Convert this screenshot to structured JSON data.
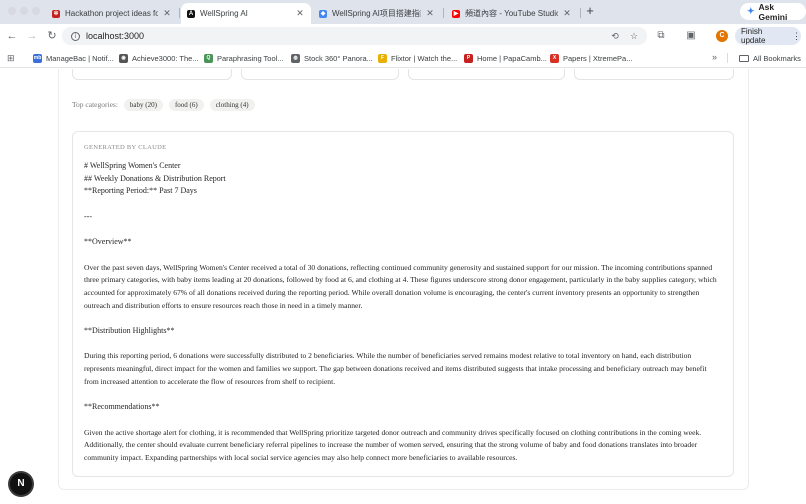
{
  "browser": {
    "tabs": [
      {
        "title": "Hackathon project ideas for a...",
        "favicon": "gear-icon",
        "favicon_color": "#c5221f",
        "active": false
      },
      {
        "title": "WellSpring AI",
        "favicon": "anthropic-icon",
        "favicon_color": "#111111",
        "active": true
      },
      {
        "title": "WellSpring AI项目搭建指南请...",
        "favicon": "chatbot-icon",
        "favicon_color": "#4285f4",
        "active": false
      },
      {
        "title": "頻道內容 - YouTube Studio",
        "favicon": "youtube-icon",
        "favicon_color": "#ff0000",
        "active": false
      }
    ],
    "new_tab_label": "+",
    "ask_gemini_label": "Ask Gemini",
    "url": "localhost:3000",
    "avatar_initial": "C",
    "finish_update_label": "Finish update",
    "bookmarks": [
      {
        "label": "ManageBac | Notif...",
        "icon": "managebac-icon",
        "color": "#3a6fd8"
      },
      {
        "label": "Achieve3000: The...",
        "icon": "person-icon",
        "color": "#555555"
      },
      {
        "label": "Paraphrasing Tool...",
        "icon": "quillbot-icon",
        "color": "#499557"
      },
      {
        "label": "Stock 360° Panora...",
        "icon": "globe-icon",
        "color": "#5f6368"
      },
      {
        "label": "Flixtor | Watch the...",
        "icon": "flixtor-icon",
        "color": "#e8b007"
      },
      {
        "label": "Home | PapaCamb...",
        "icon": "papacambridge-icon",
        "color": "#c5221f"
      },
      {
        "label": "Papers | XtremePa...",
        "icon": "xtremepapers-icon",
        "color": "#d93025"
      }
    ],
    "all_bookmarks_label": "All Bookmarks"
  },
  "page": {
    "categories_label": "Top categories:",
    "categories": [
      "baby (20)",
      "food (6)",
      "clothing (4)"
    ],
    "report": {
      "generated_by": "GENERATED BY CLAUDE",
      "heading_lines": [
        "# WellSpring Women's Center",
        "## Weekly Donations & Distribution Report",
        "**Reporting Period:** Past 7 Days"
      ],
      "separator": "---",
      "overview_heading": "**Overview**",
      "overview_text": "Over the past seven days, WellSpring Women's Center received a total of 30 donations, reflecting continued community generosity and sustained support for our mission. The incoming contributions spanned three primary categories, with baby items leading at 20 donations, followed by food at 6, and clothing at 4. These figures underscore strong donor engagement, particularly in the baby supplies category, which accounted for approximately 67% of all donations received during the reporting period. While overall donation volume is encouraging, the center's current inventory presents an opportunity to strengthen outreach and distribution efforts to ensure resources reach those in need in a timely manner.",
      "distribution_heading": "**Distribution Highlights**",
      "distribution_text": "During this reporting period, 6 donations were successfully distributed to 2 beneficiaries. While the number of beneficiaries served remains modest relative to total inventory on hand, each distribution represents meaningful, direct impact for the women and families we support. The gap between donations received and items distributed suggests that intake processing and beneficiary outreach may benefit from increased attention to accelerate the flow of resources from shelf to recipient.",
      "recommendations_heading": "**Recommendations**",
      "recommendations_text": "Given the active shortage alert for clothing, it is recommended that WellSpring prioritize targeted donor outreach and community drives specifically focused on clothing contributions in the coming week. Additionally, the center should evaluate current beneficiary referral pipelines to increase the number of women served, ensuring that the strong volume of baby and food donations translates into broader community impact. Expanding partnerships with local social service agencies may also help connect more beneficiaries to available resources."
    },
    "dev_badge": "N"
  }
}
